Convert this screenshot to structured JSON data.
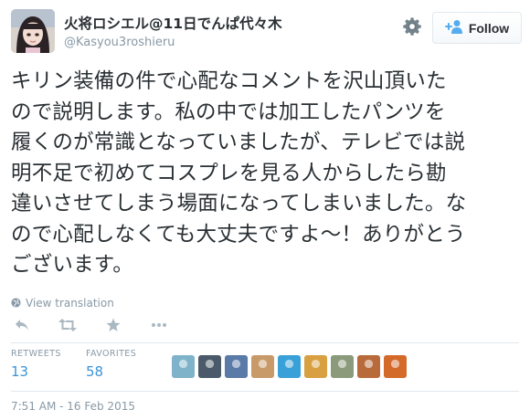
{
  "user": {
    "display_name": "火将ロシエル@11日でんぱ代々木",
    "handle": "@Kasyou3roshieru"
  },
  "follow_button": {
    "label": "Follow"
  },
  "tweet": {
    "text": "キリン装備の件で心配なコメントを沢山頂いた\nので説明します。私の中では加工したパンツを\n履くのが常識となっていましたが、テレビでは説\n明不足で初めてコスプレを見る人からしたら勘\n違いさせてしまう場面になってしまいました。な\nので心配しなくても大丈夫ですよ〜！ありがとう\nございます。",
    "view_translation": "View translation",
    "timestamp": "7:51 AM - 16 Feb 2015"
  },
  "actions": {
    "icons": [
      "reply-icon",
      "retweet-icon",
      "favorite-icon",
      "more-icon"
    ]
  },
  "stats": {
    "retweets_label": "RETWEETS",
    "retweets_count": "13",
    "favorites_label": "FAVORITES",
    "favorites_count": "58"
  },
  "colors": {
    "text": "#292f33",
    "muted": "#8899a6",
    "link": "#3b94d9",
    "border": "#e1e8ed",
    "follow_icon": "#55acee"
  },
  "favoriter_avatar_colors": [
    "#7fb3c9",
    "#4a5a6a",
    "#5a7aa8",
    "#c89a6a",
    "#3aa0d8",
    "#d8a040",
    "#8a9a7a",
    "#b86a3a",
    "#d46a2a"
  ]
}
